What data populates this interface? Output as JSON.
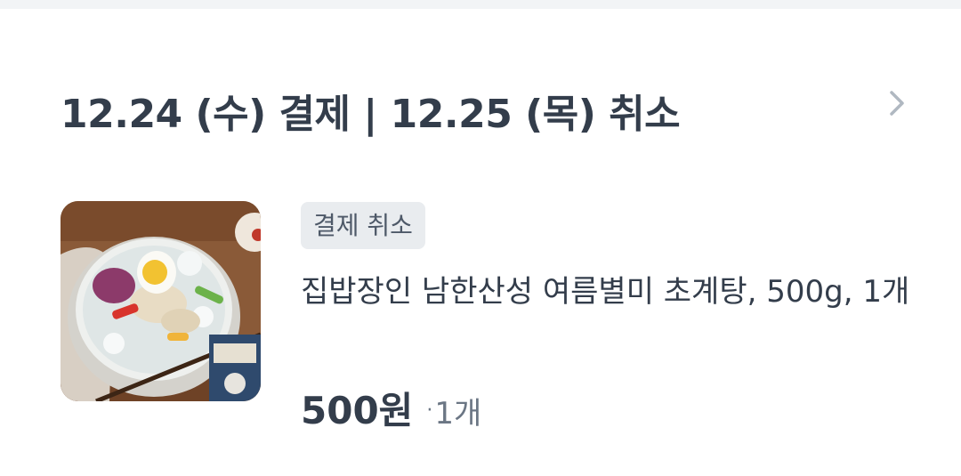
{
  "order": {
    "title": "12.24 (수) 결제 | 12.25 (목) 취소"
  },
  "item": {
    "image": "product-image",
    "status_badge": "결제 취소",
    "name": "집밥장인 남한산성 여름별미 초계탕, 500g, 1개",
    "price": "500원",
    "quantity_dot": "·",
    "quantity": "1개"
  },
  "icons": {
    "chevron": "chevron-right-icon"
  },
  "colors": {
    "text_primary": "#333d4b",
    "text_secondary": "#6b7684",
    "badge_bg": "#e9ecef",
    "chevron": "#b0b8c1"
  }
}
